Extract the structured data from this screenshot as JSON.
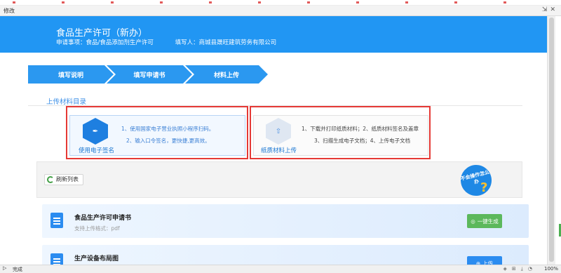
{
  "window": {
    "title": "修改"
  },
  "banner": {
    "title": "食品生产许可（新办）",
    "apply_item": "申请事项：食品/食品添加剂生产许可",
    "filler": "填写人：商城县晟旺建筑劳务有限公司"
  },
  "steps": [
    {
      "label": "填写说明"
    },
    {
      "label": "填写申请书"
    },
    {
      "label": "材料上传"
    }
  ],
  "upload": {
    "section_title": "上传材料目录",
    "electronic": {
      "label": "使用电子签名",
      "step1": "1、使用国家电子营业执照小程序扫码。",
      "step2": "2、输入口令签名，更快捷,更高效。"
    },
    "paper": {
      "label": "纸质材料上传",
      "line1": "1、下载并打印纸质材料；2、纸质材料签名及盖章",
      "line2": "3、扫描生成电子文档；4、上传电子文档"
    }
  },
  "list": {
    "refresh_label": "刷新列表",
    "helper_text": "不会操作怎么办"
  },
  "documents": [
    {
      "name": "食品生产许可申请书",
      "format": "支持上传格式：pdf",
      "action": "一键生成"
    },
    {
      "name": "生产设备布局图",
      "action": "上传"
    }
  ],
  "statusbar": {
    "status": "完成",
    "zoom": "100%"
  },
  "colors": {
    "primary": "#2196f3",
    "highlight": "#e53935",
    "generate_button": "#5cb85c"
  }
}
